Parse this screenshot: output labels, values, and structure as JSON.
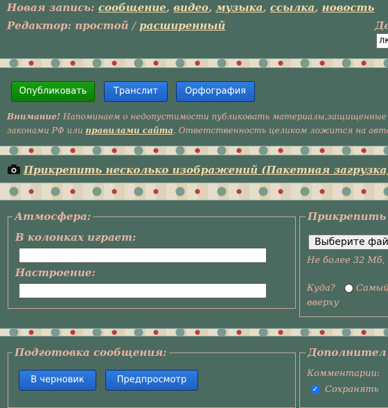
{
  "new_post": {
    "label": "Новая запись:",
    "links": [
      "сообщение",
      "видео",
      "музыка",
      "ссылка",
      "новость"
    ]
  },
  "editor": {
    "label": "Редактор:",
    "simple": "простой",
    "separator": "/",
    "extended": "расширенный"
  },
  "right_cut": {
    "label": "До",
    "input_value": "лк"
  },
  "buttons": {
    "publish": "Опубликовать",
    "translit": "Транслит",
    "spelling": "Орфография"
  },
  "warning": {
    "bold": "Внимание!",
    "line1": "Напоминаем о недопустимости публиковать материалы,защищенные",
    "line2_start": "законами РФ или",
    "link": "правилами сайта",
    "line2_end": ". Ответственность целиком ложится на автора"
  },
  "attach_many": "Прикрепить несколько изображений (Пакетная загрузка)",
  "atmosphere": {
    "legend": "Атмосфера:",
    "playing_label": "В колонках играет:",
    "playing_value": "",
    "mood_label": "Настроение:",
    "mood_value": ""
  },
  "attach": {
    "legend": "Прикрепить",
    "file_button": "Выберите фай",
    "limit": "Не более 32 Мб,",
    "where_label": "Куда?",
    "where_option": "Самый",
    "up": "вверху"
  },
  "prepare": {
    "legend": "Подготовка сообщения:",
    "draft": "В черновик",
    "preview": "Предпросмотр"
  },
  "extra": {
    "legend": "Дополнител",
    "comments": "Комментарии:",
    "save": "Сохранять"
  },
  "colors": {
    "background": "#4b6b60",
    "accent_text": "#e7b3a1",
    "link": "#f2d9a8",
    "button_blue": "#1d5fc2",
    "button_green": "#0b7d06"
  }
}
